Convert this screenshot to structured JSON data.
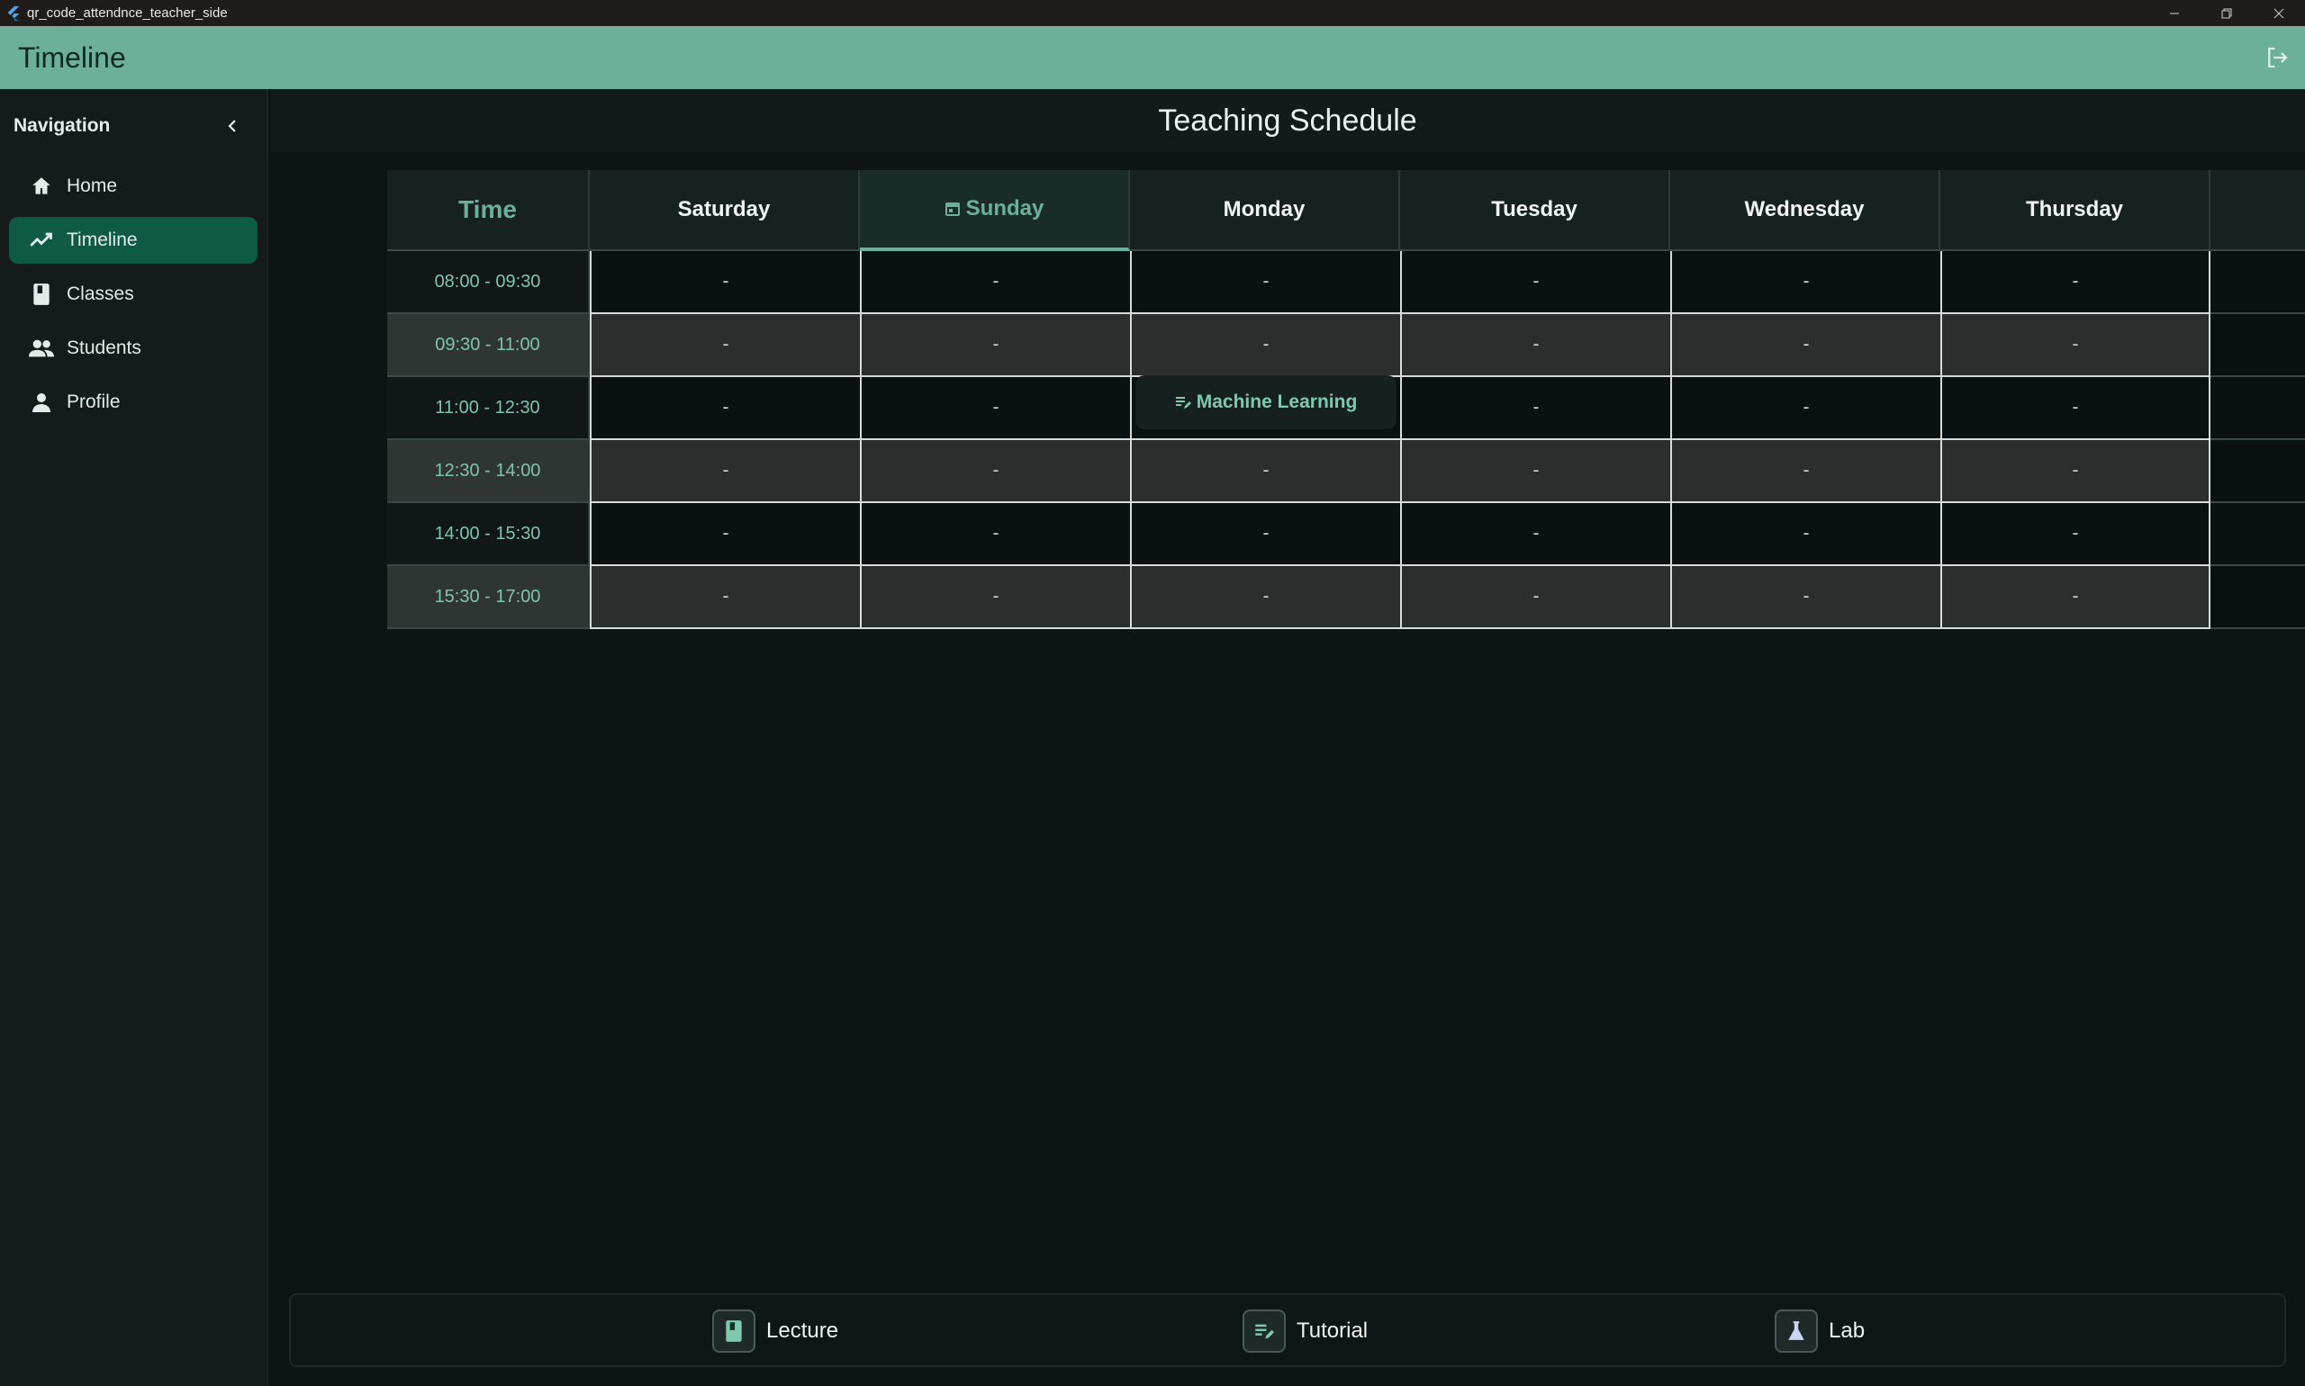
{
  "window": {
    "title": "qr_code_attendnce_teacher_side",
    "controls": [
      "minimize",
      "restore",
      "close"
    ]
  },
  "appbar": {
    "title": "Timeline",
    "logout_icon": "logout-icon"
  },
  "sidebar": {
    "title": "Navigation",
    "collapse_icon": "chevron-left-icon",
    "items": [
      {
        "label": "Home",
        "icon": "home-icon",
        "active": false
      },
      {
        "label": "Timeline",
        "icon": "timeline-icon",
        "active": true
      },
      {
        "label": "Classes",
        "icon": "book-icon",
        "active": false
      },
      {
        "label": "Students",
        "icon": "people-icon",
        "active": false
      },
      {
        "label": "Profile",
        "icon": "person-icon",
        "active": false
      }
    ]
  },
  "schedule": {
    "title": "Teaching Schedule",
    "columns": [
      "Time",
      "Saturday",
      "Sunday",
      "Monday",
      "Tuesday",
      "Wednesday",
      "Thursday"
    ],
    "today": "Sunday",
    "rows": [
      {
        "time": "08:00 - 09:30",
        "cells": [
          "-",
          "-",
          "-",
          "-",
          "-",
          "-"
        ]
      },
      {
        "time": "09:30 - 11:00",
        "cells": [
          "-",
          "-",
          "-",
          "-",
          "-",
          "-"
        ]
      },
      {
        "time": "11:00 - 12:30",
        "cells": [
          "-",
          "-",
          "Machine Learning",
          "-",
          "-",
          "-"
        ]
      },
      {
        "time": "12:30 - 14:00",
        "cells": [
          "-",
          "-",
          "-",
          "-",
          "-",
          "-"
        ]
      },
      {
        "time": "14:00 - 15:30",
        "cells": [
          "-",
          "-",
          "-",
          "-",
          "-",
          "-"
        ]
      },
      {
        "time": "15:30 - 17:00",
        "cells": [
          "-",
          "-",
          "-",
          "-",
          "-",
          "-"
        ]
      }
    ],
    "class_entry": {
      "day": "Monday",
      "slot": "11:00 - 12:30",
      "label": "Machine Learning",
      "type": "Tutorial",
      "icon": "tutorial-icon"
    }
  },
  "legend": [
    {
      "label": "Lecture",
      "icon": "book-icon"
    },
    {
      "label": "Tutorial",
      "icon": "tutorial-icon"
    },
    {
      "label": "Lab",
      "icon": "flask-icon"
    }
  ],
  "colors": {
    "accent": "#6db09a",
    "active_nav": "#0e5a45",
    "background": "#0d1413"
  }
}
